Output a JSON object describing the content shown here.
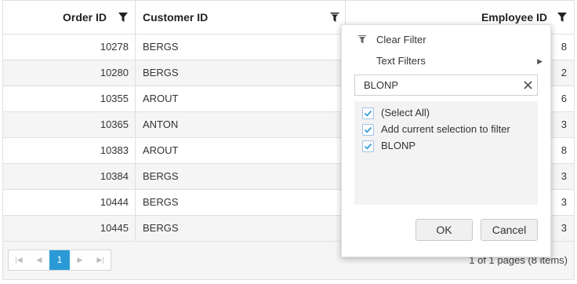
{
  "grid": {
    "columns": [
      {
        "label": "Order ID"
      },
      {
        "label": "Customer ID"
      },
      {
        "label": "Employee ID"
      }
    ],
    "rows": [
      {
        "order_id": "10278",
        "customer_id": "BERGS",
        "employee_id": "8"
      },
      {
        "order_id": "10280",
        "customer_id": "BERGS",
        "employee_id": "2"
      },
      {
        "order_id": "10355",
        "customer_id": "AROUT",
        "employee_id": "6"
      },
      {
        "order_id": "10365",
        "customer_id": "ANTON",
        "employee_id": "3"
      },
      {
        "order_id": "10383",
        "customer_id": "AROUT",
        "employee_id": "8"
      },
      {
        "order_id": "10384",
        "customer_id": "BERGS",
        "employee_id": "3"
      },
      {
        "order_id": "10444",
        "customer_id": "BERGS",
        "employee_id": "3"
      },
      {
        "order_id": "10445",
        "customer_id": "BERGS",
        "employee_id": "3"
      }
    ]
  },
  "pager": {
    "current_page": "1",
    "info": "1 of 1 pages (8 items)",
    "accent": "#2a9ad6"
  },
  "filter_popup": {
    "clear_filter": "Clear Filter",
    "text_filters": "Text Filters",
    "search_value": "BLONP",
    "items": [
      {
        "label": "(Select All)",
        "checked": true
      },
      {
        "label": "Add current selection to filter",
        "checked": true
      },
      {
        "label": "BLONP",
        "checked": true
      }
    ],
    "ok_label": "OK",
    "cancel_label": "Cancel"
  }
}
